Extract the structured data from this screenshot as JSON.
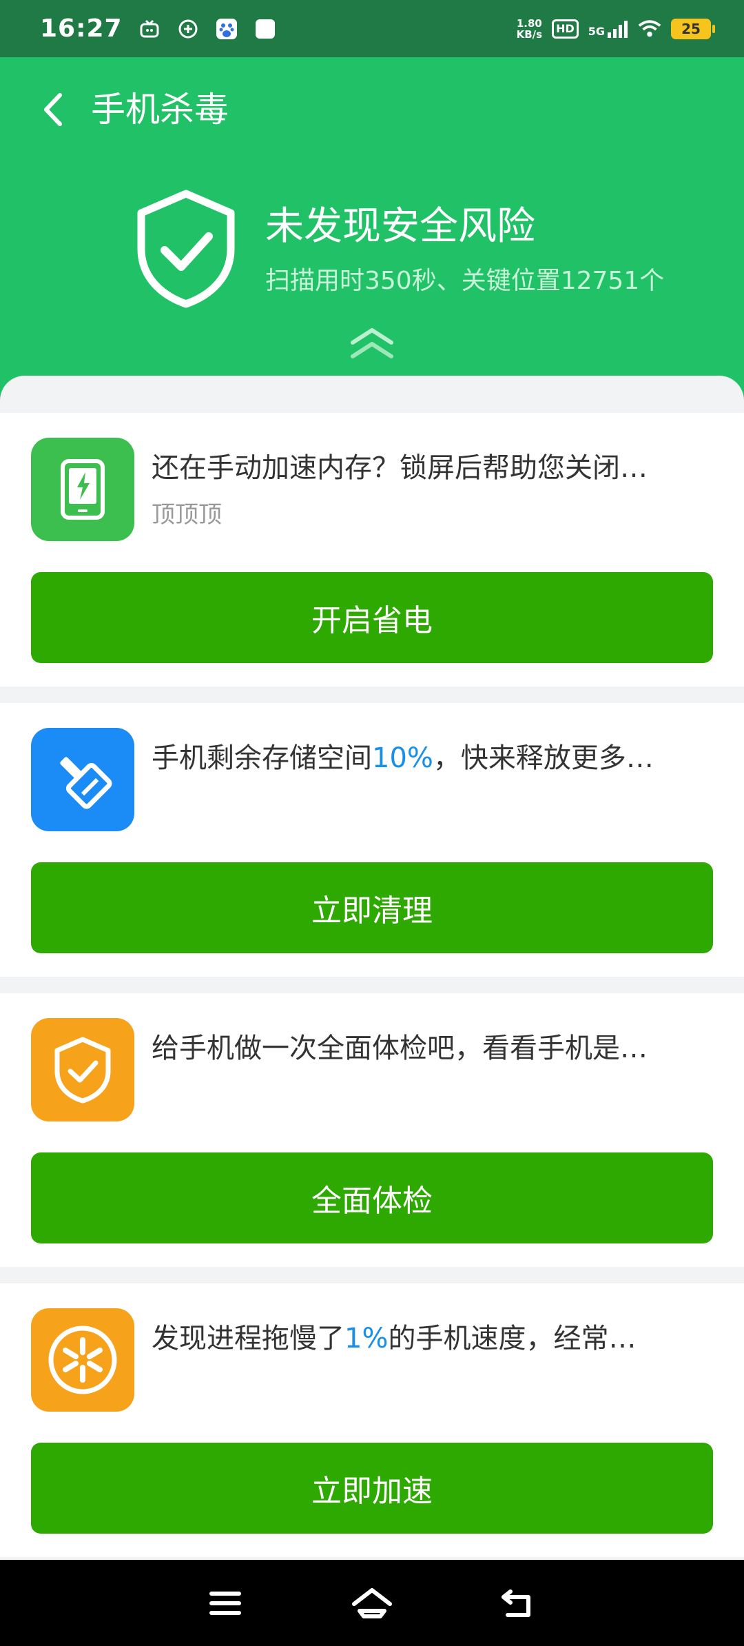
{
  "status_bar": {
    "time": "16:27",
    "net_speed_value": "1.80",
    "net_speed_unit": "KB/s",
    "hd": "HD",
    "network": "5G",
    "battery": "25"
  },
  "header": {
    "title": "手机杀毒",
    "result_title": "未发现安全风险",
    "result_subtitle": "扫描用时350秒、关键位置12751个"
  },
  "cards": [
    {
      "icon": "phone-charging-icon",
      "icon_color": "#3cbf4e",
      "text": "还在手动加速内存？锁屏后帮助您关闭…",
      "subtext": "顶顶顶",
      "button": "开启省电"
    },
    {
      "icon": "broom-icon",
      "icon_color": "#1b8bf5",
      "text_before": "手机剩余存储空间",
      "text_highlight": "10%",
      "text_after": "，快来释放更多…",
      "button": "立即清理"
    },
    {
      "icon": "shield-check-icon",
      "icon_color": "#f7a21b",
      "text": "给手机做一次全面体检吧，看看手机是…",
      "button": "全面体检"
    },
    {
      "icon": "speed-wheel-icon",
      "icon_color": "#f7a21b",
      "text_before": "发现进程拖慢了",
      "text_highlight": "1%",
      "text_after": "的手机速度，经常…",
      "button": "立即加速"
    }
  ],
  "colors": {
    "header_green": "#21c267",
    "button_green": "#2ea902",
    "highlight_blue": "#1890e8"
  }
}
